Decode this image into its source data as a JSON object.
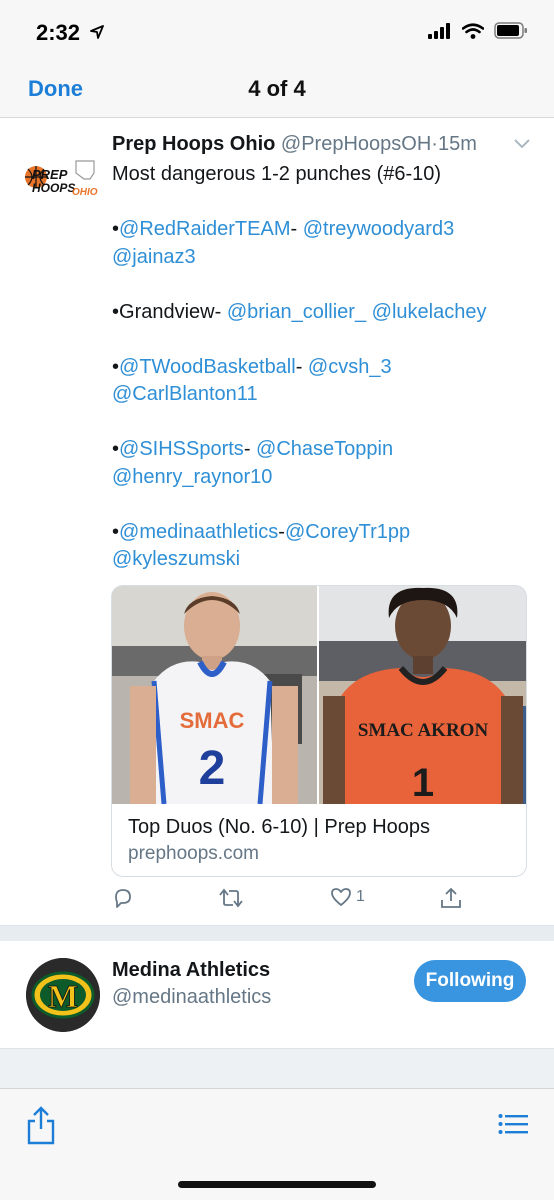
{
  "status_bar": {
    "time": "2:32"
  },
  "nav": {
    "done_label": "Done",
    "title": "4 of 4"
  },
  "tweet": {
    "name": "Prep Hoops Ohio",
    "handle": "@PrepHoopsOH",
    "separator": "·",
    "time": "15m",
    "logo_text": {
      "line1": "PREP",
      "line2": "HOOPS",
      "line3": "OHIO"
    },
    "line1": "Most dangerous 1-2 punches (#6-10)",
    "block1": {
      "bullet": "•",
      "m1": "@RedRaiderTEAM",
      "sep": "- ",
      "m2": "@treywoodyard3",
      "m3": "@jainaz3"
    },
    "block2": {
      "bullet": "•",
      "team": "Grandview- ",
      "m1": "@brian_collier_",
      "m2": "@lukelachey"
    },
    "block3": {
      "bullet": "•",
      "m1": "@TWoodBasketball",
      "sep": "- ",
      "m2": "@cvsh_3",
      "m3": "@CarlBlanton11"
    },
    "block4": {
      "bullet": "•",
      "m1": "@SIHSSports",
      "sep": "- ",
      "m2": "@ChaseToppin",
      "m3": "@henry_raynor10"
    },
    "block5": {
      "bullet": "•",
      "m1": "@medinaathletics",
      "sep": "-",
      "m2": "@CoreyTr1pp",
      "m3": "@kyleszumski"
    },
    "card": {
      "title": "Top Duos (No. 6-10) | Prep Hoops",
      "domain": "prephoops.com",
      "left_jersey_text": "SMAC",
      "left_jersey_number": "2",
      "right_jersey_text": "SMAC AKRON",
      "right_jersey_number": "1"
    },
    "actions": {
      "like_count": "1"
    }
  },
  "profile": {
    "name": "Medina Athletics",
    "handle": "@medinaathletics",
    "follow_label": "Following",
    "avatar_letter": "M"
  },
  "colors": {
    "accent": "#1d7ed8",
    "mention": "#2f8fd6",
    "follow_button": "#3a95e0",
    "secondary_text": "#657786"
  }
}
